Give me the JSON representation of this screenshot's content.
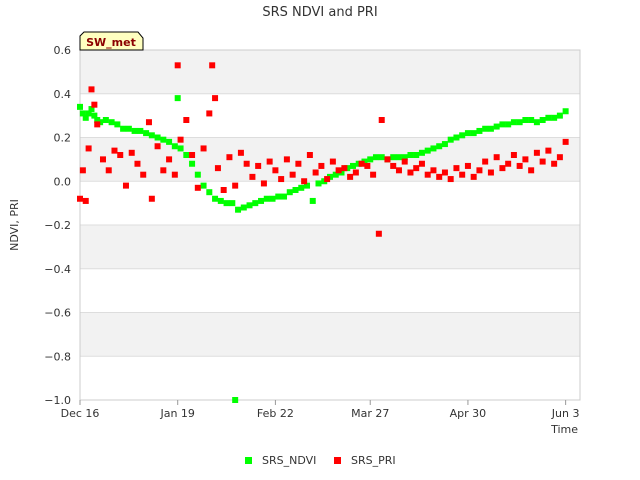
{
  "chart_data": {
    "type": "scatter",
    "title": "SRS NDVI and PRI",
    "xlabel": "Time",
    "ylabel": "NDVI, PRI",
    "site_label": "SW_met",
    "x_type": "date",
    "xlim": [
      "2022-12-16",
      "2023-06-08"
    ],
    "ylim": [
      -1.0,
      0.6
    ],
    "grid": true,
    "legend_position": "bottom",
    "x_ticks": [
      {
        "date": "2022-12-16",
        "label": "Dec 16"
      },
      {
        "date": "2023-01-19",
        "label": "Jan 19"
      },
      {
        "date": "2023-02-22",
        "label": "Feb 22"
      },
      {
        "date": "2023-03-27",
        "label": "Mar 27"
      },
      {
        "date": "2023-04-30",
        "label": "Apr 30"
      },
      {
        "date": "2023-06-03",
        "label": "Jun 3"
      }
    ],
    "y_ticks": [
      0.6,
      0.4,
      0.2,
      0.0,
      -0.2,
      -0.4,
      -0.6,
      -0.8,
      -1.0
    ],
    "y_tick_labels": [
      "0.6",
      "0.4",
      "0.2",
      "0.0",
      "−0.2",
      "−0.4",
      "−0.6",
      "−0.8",
      "−1.0"
    ],
    "series": [
      {
        "name": "SRS_NDVI",
        "color": "#00ff00",
        "points": [
          [
            "2022-12-16",
            0.34
          ],
          [
            "2022-12-17",
            0.31
          ],
          [
            "2022-12-18",
            0.29
          ],
          [
            "2022-12-19",
            0.31
          ],
          [
            "2022-12-20",
            0.33
          ],
          [
            "2022-12-21",
            0.3
          ],
          [
            "2022-12-22",
            0.28
          ],
          [
            "2022-12-23",
            0.27
          ],
          [
            "2022-12-25",
            0.28
          ],
          [
            "2022-12-27",
            0.27
          ],
          [
            "2022-12-29",
            0.26
          ],
          [
            "2022-12-31",
            0.24
          ],
          [
            "2023-01-02",
            0.24
          ],
          [
            "2023-01-04",
            0.23
          ],
          [
            "2023-01-06",
            0.23
          ],
          [
            "2023-01-08",
            0.22
          ],
          [
            "2023-01-10",
            0.21
          ],
          [
            "2023-01-12",
            0.2
          ],
          [
            "2023-01-14",
            0.19
          ],
          [
            "2023-01-16",
            0.18
          ],
          [
            "2023-01-18",
            0.16
          ],
          [
            "2023-01-19",
            0.38
          ],
          [
            "2023-01-20",
            0.15
          ],
          [
            "2023-01-22",
            0.12
          ],
          [
            "2023-01-24",
            0.08
          ],
          [
            "2023-01-26",
            0.03
          ],
          [
            "2023-01-28",
            -0.02
          ],
          [
            "2023-01-30",
            -0.05
          ],
          [
            "2023-02-01",
            -0.08
          ],
          [
            "2023-02-03",
            -0.09
          ],
          [
            "2023-02-05",
            -0.1
          ],
          [
            "2023-02-07",
            -0.1
          ],
          [
            "2023-02-08",
            -1.0
          ],
          [
            "2023-02-09",
            -0.13
          ],
          [
            "2023-02-11",
            -0.12
          ],
          [
            "2023-02-13",
            -0.11
          ],
          [
            "2023-02-15",
            -0.1
          ],
          [
            "2023-02-17",
            -0.09
          ],
          [
            "2023-02-19",
            -0.08
          ],
          [
            "2023-02-21",
            -0.08
          ],
          [
            "2023-02-23",
            -0.07
          ],
          [
            "2023-02-25",
            -0.07
          ],
          [
            "2023-02-27",
            -0.05
          ],
          [
            "2023-03-01",
            -0.04
          ],
          [
            "2023-03-03",
            -0.03
          ],
          [
            "2023-03-05",
            -0.02
          ],
          [
            "2023-03-07",
            -0.09
          ],
          [
            "2023-03-09",
            -0.01
          ],
          [
            "2023-03-11",
            0.0
          ],
          [
            "2023-03-13",
            0.02
          ],
          [
            "2023-03-15",
            0.03
          ],
          [
            "2023-03-17",
            0.04
          ],
          [
            "2023-03-19",
            0.06
          ],
          [
            "2023-03-21",
            0.07
          ],
          [
            "2023-03-23",
            0.08
          ],
          [
            "2023-03-25",
            0.09
          ],
          [
            "2023-03-27",
            0.1
          ],
          [
            "2023-03-29",
            0.11
          ],
          [
            "2023-03-31",
            0.11
          ],
          [
            "2023-04-02",
            0.1
          ],
          [
            "2023-04-04",
            0.11
          ],
          [
            "2023-04-06",
            0.11
          ],
          [
            "2023-04-08",
            0.11
          ],
          [
            "2023-04-10",
            0.12
          ],
          [
            "2023-04-12",
            0.12
          ],
          [
            "2023-04-14",
            0.13
          ],
          [
            "2023-04-16",
            0.14
          ],
          [
            "2023-04-18",
            0.15
          ],
          [
            "2023-04-20",
            0.16
          ],
          [
            "2023-04-22",
            0.17
          ],
          [
            "2023-04-24",
            0.19
          ],
          [
            "2023-04-26",
            0.2
          ],
          [
            "2023-04-28",
            0.21
          ],
          [
            "2023-04-30",
            0.22
          ],
          [
            "2023-05-02",
            0.22
          ],
          [
            "2023-05-04",
            0.23
          ],
          [
            "2023-05-06",
            0.24
          ],
          [
            "2023-05-08",
            0.24
          ],
          [
            "2023-05-10",
            0.25
          ],
          [
            "2023-05-12",
            0.26
          ],
          [
            "2023-05-14",
            0.26
          ],
          [
            "2023-05-16",
            0.27
          ],
          [
            "2023-05-18",
            0.27
          ],
          [
            "2023-05-20",
            0.28
          ],
          [
            "2023-05-22",
            0.28
          ],
          [
            "2023-05-24",
            0.27
          ],
          [
            "2023-05-26",
            0.28
          ],
          [
            "2023-05-28",
            0.29
          ],
          [
            "2023-05-30",
            0.29
          ],
          [
            "2023-06-01",
            0.3
          ],
          [
            "2023-06-03",
            0.32
          ]
        ]
      },
      {
        "name": "SRS_PRI",
        "color": "#ff0000",
        "points": [
          [
            "2022-12-16",
            -0.08
          ],
          [
            "2022-12-17",
            0.05
          ],
          [
            "2022-12-18",
            -0.09
          ],
          [
            "2022-12-19",
            0.15
          ],
          [
            "2022-12-20",
            0.42
          ],
          [
            "2022-12-21",
            0.35
          ],
          [
            "2022-12-22",
            0.26
          ],
          [
            "2022-12-24",
            0.1
          ],
          [
            "2022-12-26",
            0.05
          ],
          [
            "2022-12-28",
            0.14
          ],
          [
            "2022-12-30",
            0.12
          ],
          [
            "2023-01-01",
            -0.02
          ],
          [
            "2023-01-03",
            0.13
          ],
          [
            "2023-01-05",
            0.08
          ],
          [
            "2023-01-07",
            0.03
          ],
          [
            "2023-01-09",
            0.27
          ],
          [
            "2023-01-10",
            -0.08
          ],
          [
            "2023-01-12",
            0.16
          ],
          [
            "2023-01-14",
            0.05
          ],
          [
            "2023-01-16",
            0.1
          ],
          [
            "2023-01-18",
            0.03
          ],
          [
            "2023-01-19",
            0.53
          ],
          [
            "2023-01-20",
            0.19
          ],
          [
            "2023-01-22",
            0.28
          ],
          [
            "2023-01-24",
            0.12
          ],
          [
            "2023-01-26",
            -0.03
          ],
          [
            "2023-01-28",
            0.15
          ],
          [
            "2023-01-30",
            0.31
          ],
          [
            "2023-01-31",
            0.53
          ],
          [
            "2023-02-01",
            0.38
          ],
          [
            "2023-02-02",
            0.06
          ],
          [
            "2023-02-04",
            -0.04
          ],
          [
            "2023-02-06",
            0.11
          ],
          [
            "2023-02-08",
            -0.02
          ],
          [
            "2023-02-10",
            0.13
          ],
          [
            "2023-02-12",
            0.08
          ],
          [
            "2023-02-14",
            0.02
          ],
          [
            "2023-02-16",
            0.07
          ],
          [
            "2023-02-18",
            -0.01
          ],
          [
            "2023-02-20",
            0.09
          ],
          [
            "2023-02-22",
            0.05
          ],
          [
            "2023-02-24",
            0.01
          ],
          [
            "2023-02-26",
            0.1
          ],
          [
            "2023-02-28",
            0.03
          ],
          [
            "2023-03-02",
            0.08
          ],
          [
            "2023-03-04",
            0.0
          ],
          [
            "2023-03-06",
            0.12
          ],
          [
            "2023-03-08",
            0.04
          ],
          [
            "2023-03-10",
            0.07
          ],
          [
            "2023-03-12",
            0.01
          ],
          [
            "2023-03-14",
            0.09
          ],
          [
            "2023-03-16",
            0.05
          ],
          [
            "2023-03-18",
            0.06
          ],
          [
            "2023-03-20",
            0.02
          ],
          [
            "2023-03-22",
            0.04
          ],
          [
            "2023-03-24",
            0.08
          ],
          [
            "2023-03-26",
            0.07
          ],
          [
            "2023-03-28",
            0.03
          ],
          [
            "2023-03-30",
            -0.24
          ],
          [
            "2023-03-31",
            0.28
          ],
          [
            "2023-04-02",
            0.1
          ],
          [
            "2023-04-04",
            0.07
          ],
          [
            "2023-04-06",
            0.05
          ],
          [
            "2023-04-08",
            0.09
          ],
          [
            "2023-04-10",
            0.04
          ],
          [
            "2023-04-12",
            0.06
          ],
          [
            "2023-04-14",
            0.08
          ],
          [
            "2023-04-16",
            0.03
          ],
          [
            "2023-04-18",
            0.05
          ],
          [
            "2023-04-20",
            0.02
          ],
          [
            "2023-04-22",
            0.04
          ],
          [
            "2023-04-24",
            0.01
          ],
          [
            "2023-04-26",
            0.06
          ],
          [
            "2023-04-28",
            0.03
          ],
          [
            "2023-04-30",
            0.07
          ],
          [
            "2023-05-02",
            0.02
          ],
          [
            "2023-05-04",
            0.05
          ],
          [
            "2023-05-06",
            0.09
          ],
          [
            "2023-05-08",
            0.04
          ],
          [
            "2023-05-10",
            0.11
          ],
          [
            "2023-05-12",
            0.06
          ],
          [
            "2023-05-14",
            0.08
          ],
          [
            "2023-05-16",
            0.12
          ],
          [
            "2023-05-18",
            0.07
          ],
          [
            "2023-05-20",
            0.1
          ],
          [
            "2023-05-22",
            0.05
          ],
          [
            "2023-05-24",
            0.13
          ],
          [
            "2023-05-26",
            0.09
          ],
          [
            "2023-05-28",
            0.14
          ],
          [
            "2023-05-30",
            0.08
          ],
          [
            "2023-06-01",
            0.11
          ],
          [
            "2023-06-03",
            0.18
          ]
        ]
      }
    ]
  }
}
